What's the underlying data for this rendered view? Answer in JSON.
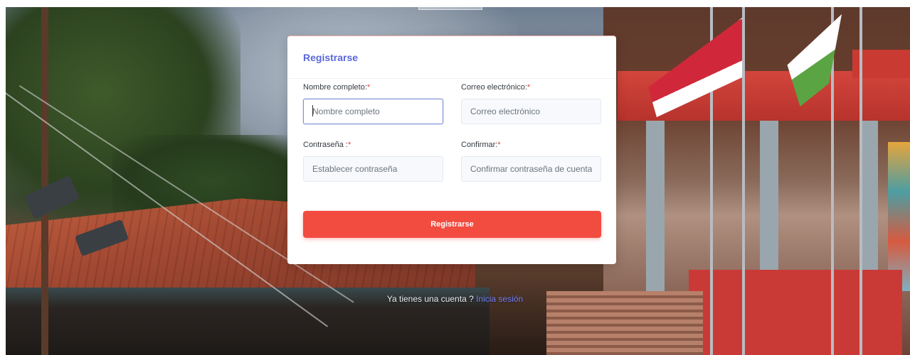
{
  "form": {
    "title": "Registrarse",
    "full_name": {
      "label": "Nombre completo:",
      "required_mark": "*",
      "placeholder": "Nombre completo"
    },
    "email": {
      "label": "Correo electrónico:",
      "required_mark": "*",
      "placeholder": "Correo electrónico"
    },
    "password": {
      "label": "Contraseña :",
      "required_mark": "*",
      "placeholder": "Establecer contraseña"
    },
    "confirm": {
      "label": "Confirmar:",
      "required_mark": "*",
      "placeholder": "Confirmar contraseña de cuenta"
    },
    "submit_label": "Registrarse"
  },
  "footer": {
    "prompt": "Ya tienes una cuenta ? ",
    "login_link": "Inicia sesión"
  },
  "colors": {
    "accent": "#5a67d8",
    "button": "#f24b40",
    "required": "#e3443b"
  }
}
